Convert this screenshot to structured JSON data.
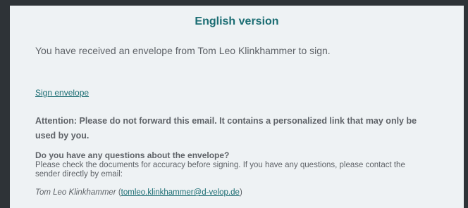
{
  "email": {
    "title": "English version",
    "intro": "You have received an envelope from Tom Leo Klinkhammer to sign.",
    "sign_link": "Sign envelope",
    "attention": "Attention: Please do not forward this email. It contains a personalized link that may only be used by you.",
    "questions": {
      "heading": "Do you have any questions about the envelope?",
      "body": "Please check the documents for accuracy before signing. If you have any questions, please contact the sender directly by email:",
      "sender_name": "Tom Leo Klinkhammer",
      "open_paren": " (",
      "sender_email": "tomleo.klinkhammer@d-velop.de",
      "close_paren": ")"
    }
  },
  "colors": {
    "background": "#2e3337",
    "card": "#eef2f4",
    "accent": "#1b6d73",
    "text": "#5f6368"
  }
}
